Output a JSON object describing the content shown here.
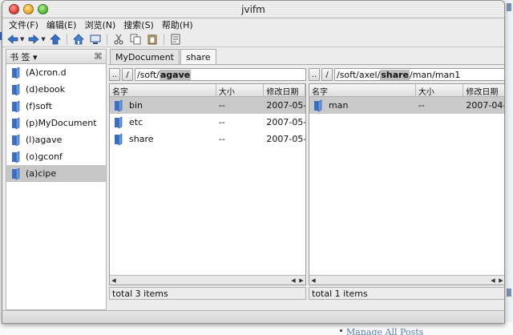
{
  "window": {
    "title": "jvifm"
  },
  "menu": [
    {
      "label": "文件(F)"
    },
    {
      "label": "编辑(E)"
    },
    {
      "label": "浏览(N)"
    },
    {
      "label": "搜索(S)"
    },
    {
      "label": "帮助(H)"
    }
  ],
  "bookmarks": {
    "title": "书 签 ▾",
    "close_glyph": "⌘",
    "items": [
      {
        "label": "(A)cron.d"
      },
      {
        "label": "(d)ebook"
      },
      {
        "label": "(f)soft"
      },
      {
        "label": "(p)MyDocument"
      },
      {
        "label": "(l)agave"
      },
      {
        "label": "(o)gconf"
      },
      {
        "label": "(a)cipe",
        "selected": true
      }
    ]
  },
  "tabs": [
    {
      "label": "MyDocument",
      "active": false
    },
    {
      "label": "share",
      "active": true
    }
  ],
  "left_panel": {
    "up_btn": "..",
    "root_btn": "/",
    "path_prefix": "/soft/",
    "path_highlight": "agave",
    "path_suffix": "",
    "columns": [
      "名字",
      "大小",
      "修改日期"
    ],
    "rows": [
      {
        "name": "bin",
        "size": "--",
        "date": "2007-05-",
        "selected": true
      },
      {
        "name": "etc",
        "size": "--",
        "date": "2007-05-"
      },
      {
        "name": "share",
        "size": "--",
        "date": "2007-05-"
      }
    ],
    "status": "total 3 items"
  },
  "right_panel": {
    "up_btn": "..",
    "root_btn": "/",
    "path_prefix": "/soft/axel/",
    "path_highlight": "share",
    "path_suffix": "/man/man1",
    "columns": [
      "名字",
      "大小",
      "修改日期"
    ],
    "rows": [
      {
        "name": "man",
        "size": "--",
        "date": "2007-04-",
        "selected": true
      }
    ],
    "status": "total 1 items"
  },
  "background": {
    "link_text": "Manage All Posts"
  },
  "colors": {
    "folder_blue": "#3a6fc4",
    "selection": "#c6c6c6"
  }
}
